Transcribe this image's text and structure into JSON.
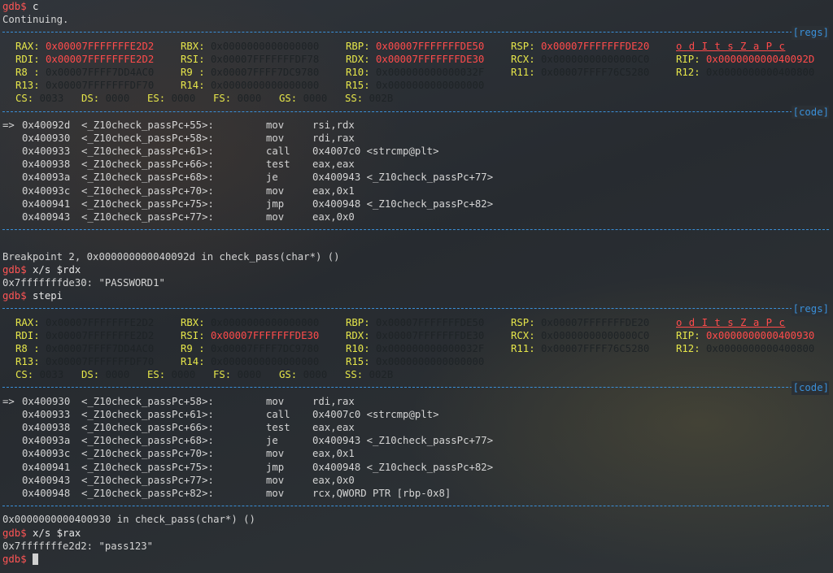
{
  "terminal": {
    "prompt": "gdb$",
    "cmd1": "c",
    "continuing": "Continuing.",
    "tag_regs": "[regs]",
    "tag_code": "[code]",
    "block1": {
      "regs": [
        [
          [
            "RAX:",
            "0x00007FFFFFFFE2D2",
            "chg"
          ],
          [
            "RBX:",
            "0x0000000000000000",
            "dim"
          ],
          [
            "RBP:",
            "0x00007FFFFFFFDE50",
            "chg"
          ],
          [
            "RSP:",
            "0x00007FFFFFFFDE20",
            "chg"
          ],
          [
            "",
            "o d I t s Z a P c",
            "flags"
          ]
        ],
        [
          [
            "RDI:",
            "0x00007FFFFFFFE2D2",
            "chg"
          ],
          [
            "RSI:",
            "0x00007FFFFFFFDF78",
            "dim"
          ],
          [
            "RDX:",
            "0x00007FFFFFFFDE30",
            "chg"
          ],
          [
            "RCX:",
            "0x00000000000000C0",
            "dim"
          ],
          [
            "RIP:",
            "0x000000000040092D",
            "chg"
          ]
        ],
        [
          [
            "R8 :",
            "0x00007FFFF7DD4AC0",
            "dim"
          ],
          [
            "R9 :",
            "0x00007FFFF7DC9780",
            "dim"
          ],
          [
            "R10:",
            "0x000000000000032F",
            "dim"
          ],
          [
            "R11:",
            "0x00007FFFF76C5280",
            "dim"
          ],
          [
            "R12:",
            "0x0000000000400800",
            "dim"
          ]
        ],
        [
          [
            "R13:",
            "0x00007FFFFFFFDF70",
            "dim"
          ],
          [
            "R14:",
            "0x0000000000000000",
            "dim"
          ],
          [
            "R15:",
            "0x0000000000000000",
            "dim"
          ]
        ]
      ],
      "seg": [
        [
          "CS:",
          "0033"
        ],
        [
          "DS:",
          "0000"
        ],
        [
          "ES:",
          "0000"
        ],
        [
          "FS:",
          "0000"
        ],
        [
          "GS:",
          "0000"
        ],
        [
          "SS:",
          "002B"
        ]
      ],
      "code": [
        [
          "=> ",
          "0x40092d",
          "<_Z10check_passPc+55>:",
          "mov",
          "rsi,rdx"
        ],
        [
          "   ",
          "0x400930",
          "<_Z10check_passPc+58>:",
          "mov",
          "rdi,rax"
        ],
        [
          "   ",
          "0x400933",
          "<_Z10check_passPc+61>:",
          "call",
          "0x4007c0 <strcmp@plt>"
        ],
        [
          "   ",
          "0x400938",
          "<_Z10check_passPc+66>:",
          "test",
          "eax,eax"
        ],
        [
          "   ",
          "0x40093a",
          "<_Z10check_passPc+68>:",
          "je",
          "0x400943 <_Z10check_passPc+77>"
        ],
        [
          "   ",
          "0x40093c",
          "<_Z10check_passPc+70>:",
          "mov",
          "eax,0x1"
        ],
        [
          "   ",
          "0x400941",
          "<_Z10check_passPc+75>:",
          "jmp",
          "0x400948 <_Z10check_passPc+82>"
        ],
        [
          "   ",
          "0x400943",
          "<_Z10check_passPc+77>:",
          "mov",
          "eax,0x0"
        ]
      ]
    },
    "breakpoint_line": "Breakpoint 2, 0x000000000040092d in check_pass(char*) ()",
    "cmd2": "x/s $rdx",
    "out2": "0x7fffffffde30: \"PASSWORD1\"",
    "cmd3": "stepi",
    "block2": {
      "regs": [
        [
          [
            "RAX:",
            "0x00007FFFFFFFE2D2",
            "dim"
          ],
          [
            "RBX:",
            "0x0000000000000000",
            "dim"
          ],
          [
            "RBP:",
            "0x00007FFFFFFFDE50",
            "dim"
          ],
          [
            "RSP:",
            "0x00007FFFFFFFDE20",
            "dim"
          ],
          [
            "",
            "o d I t s Z a P c",
            "flags"
          ]
        ],
        [
          [
            "RDI:",
            "0x00007FFFFFFFE2D2",
            "dim"
          ],
          [
            "RSI:",
            "0x00007FFFFFFFDE30",
            "chg"
          ],
          [
            "RDX:",
            "0x00007FFFFFFFDE30",
            "dim"
          ],
          [
            "RCX:",
            "0x00000000000000C0",
            "dim"
          ],
          [
            "RIP:",
            "0x0000000000400930",
            "chg"
          ]
        ],
        [
          [
            "R8 :",
            "0x00007FFFF7DD4AC0",
            "dim"
          ],
          [
            "R9 :",
            "0x00007FFFF7DC9780",
            "dim"
          ],
          [
            "R10:",
            "0x000000000000032F",
            "dim"
          ],
          [
            "R11:",
            "0x00007FFFF76C5280",
            "dim"
          ],
          [
            "R12:",
            "0x0000000000400800",
            "dim"
          ]
        ],
        [
          [
            "R13:",
            "0x00007FFFFFFFDF70",
            "dim"
          ],
          [
            "R14:",
            "0x0000000000000000",
            "dim"
          ],
          [
            "R15:",
            "0x0000000000000000",
            "dim"
          ]
        ]
      ],
      "seg": [
        [
          "CS:",
          "0033"
        ],
        [
          "DS:",
          "0000"
        ],
        [
          "ES:",
          "0000"
        ],
        [
          "FS:",
          "0000"
        ],
        [
          "GS:",
          "0000"
        ],
        [
          "SS:",
          "002B"
        ]
      ],
      "code": [
        [
          "=> ",
          "0x400930",
          "<_Z10check_passPc+58>:",
          "mov",
          "rdi,rax"
        ],
        [
          "   ",
          "0x400933",
          "<_Z10check_passPc+61>:",
          "call",
          "0x4007c0 <strcmp@plt>"
        ],
        [
          "   ",
          "0x400938",
          "<_Z10check_passPc+66>:",
          "test",
          "eax,eax"
        ],
        [
          "   ",
          "0x40093a",
          "<_Z10check_passPc+68>:",
          "je",
          "0x400943 <_Z10check_passPc+77>"
        ],
        [
          "   ",
          "0x40093c",
          "<_Z10check_passPc+70>:",
          "mov",
          "eax,0x1"
        ],
        [
          "   ",
          "0x400941",
          "<_Z10check_passPc+75>:",
          "jmp",
          "0x400948 <_Z10check_passPc+82>"
        ],
        [
          "   ",
          "0x400943",
          "<_Z10check_passPc+77>:",
          "mov",
          "eax,0x0"
        ],
        [
          "   ",
          "0x400948",
          "<_Z10check_passPc+82>:",
          "mov",
          "rcx,QWORD PTR [rbp-0x8]"
        ]
      ]
    },
    "stop_line": "0x0000000000400930 in check_pass(char*) ()",
    "cmd4": "x/s $rax",
    "out4": "0x7fffffffe2d2: \"pass123\"",
    "colors": {
      "prompt": "#ff5555",
      "regname": "#e6e64a",
      "changed": "#ff4b4b",
      "separator": "#3a8fd8"
    }
  }
}
